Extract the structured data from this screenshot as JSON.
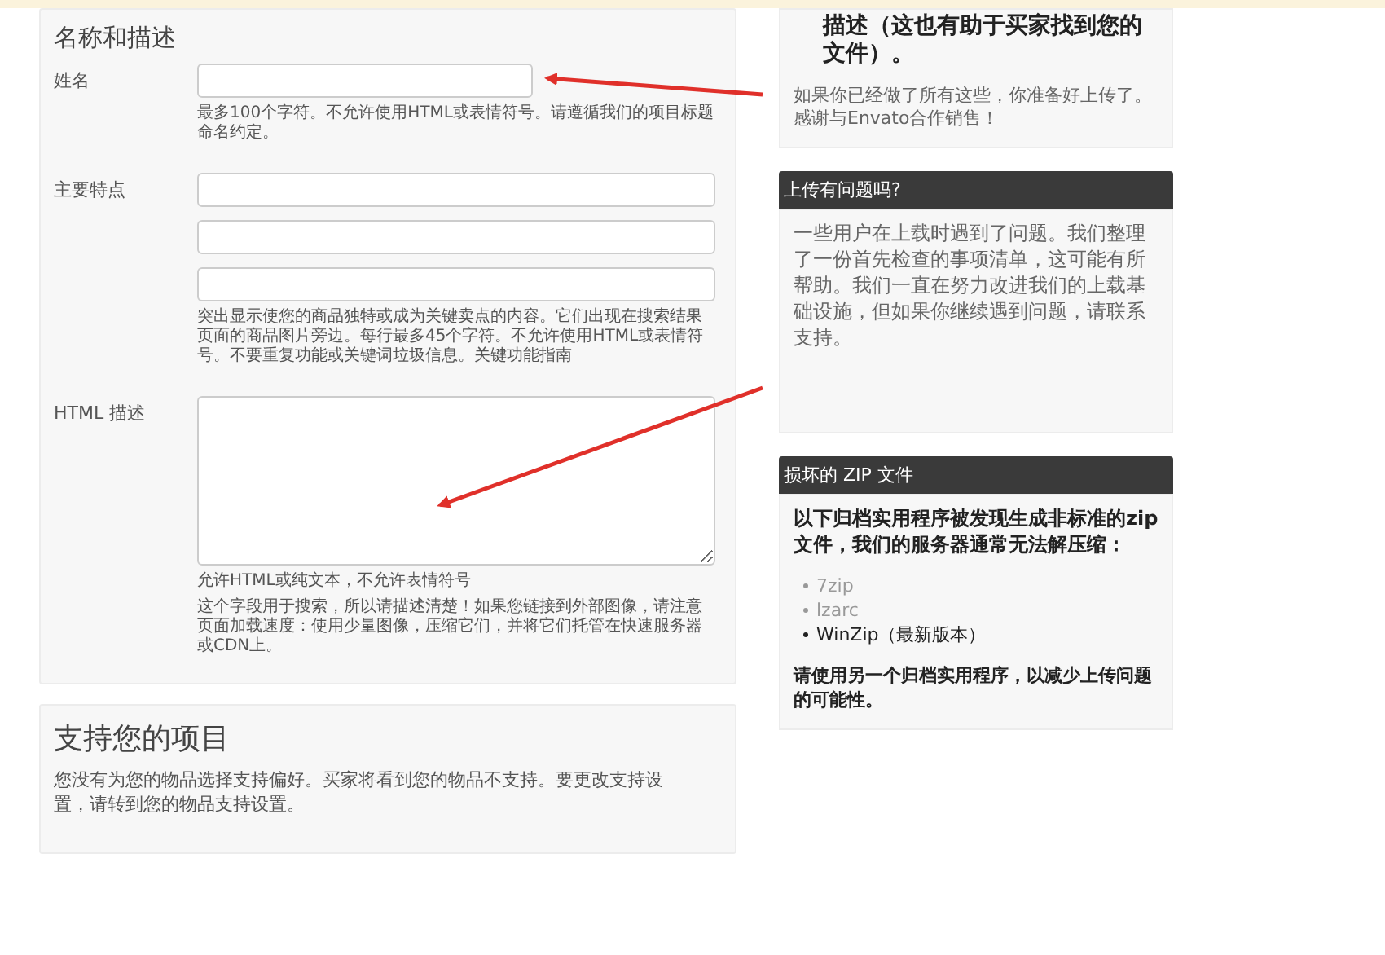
{
  "form": {
    "title": "名称和描述",
    "fields": [
      {
        "label": "姓名",
        "kind": "short",
        "hints": [
          "最多100个字符。不允许使用HTML或表情符号。请遵循我们的项目标题命名约定。"
        ]
      },
      {
        "label": "主要特点",
        "kind": "wide"
      },
      {
        "kind": "wide"
      },
      {
        "kind": "wide",
        "hints": [
          "突出显示使您的商品独特或成为关键卖点的内容。它们出现在搜索结果页面的商品图片旁边。每行最多45个字符。不允许使用HTML或表情符号。不要重复功能或关键词垃圾信息。关键功能指南"
        ]
      },
      {
        "label": "HTML 描述",
        "kind": "textarea",
        "hints": [
          "允许HTML或纯文本，不允许表情符号",
          "这个字段用于搜索，所以请描述清楚！如果您链接到外部图像，请注意页面加载速度：使用少量图像，压缩它们，并将它们托管在快速服务器或CDN上。"
        ]
      }
    ]
  },
  "support": {
    "title": "支持您的项目",
    "text": "您没有为您的物品选择支持偏好。买家将看到您的物品不支持。要更改支持设置，请转到您的物品支持设置。"
  },
  "tips": [
    {
      "kind": "plain",
      "bold_text": "描述（这也有助于买家找到您的文件）。",
      "text": "如果你已经做了所有这些，你准备好上传了。感谢与Envato合作销售！"
    },
    {
      "kind": "titled",
      "title": "上传有问题吗?",
      "text": "一些用户在上载时遇到了问题。我们整理了一份首先检查的事项清单，这可能有所帮助。我们一直在努力改进我们的上载基础设施，但如果你继续遇到问题，请联系支持。"
    },
    {
      "kind": "titled",
      "title": "损坏的 ZIP 文件",
      "lead": "以下归档实用程序被发现生成非标准的zip文件，我们的服务器通常无法解压缩：",
      "list": [
        {
          "text": "7zip",
          "muted": true
        },
        {
          "text": "lzarc",
          "muted": true
        },
        {
          "text": "WinZip（最新版本）",
          "muted": false
        }
      ],
      "closing": "请使用另一个归档实用程序，以减少上传问题的可能性。"
    }
  ]
}
